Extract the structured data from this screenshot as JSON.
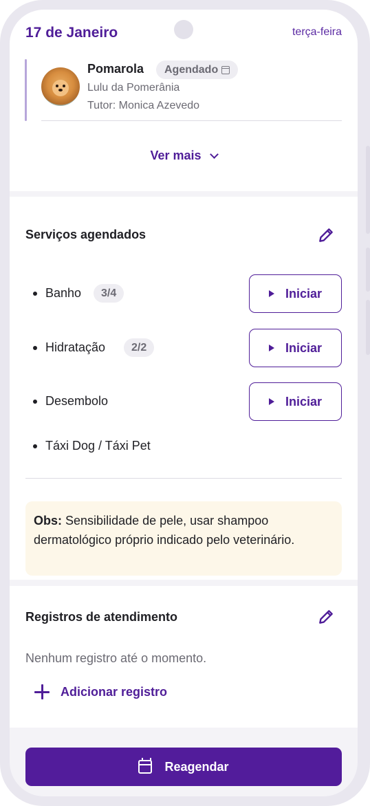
{
  "header": {
    "date": "17 de Janeiro",
    "weekday": "terça-feira"
  },
  "pet": {
    "name": "Pomarola",
    "status": "Agendado",
    "breed": "Lulu da Pomerânia",
    "tutor": "Tutor: Monica Azevedo",
    "status_icon": "calendar-icon"
  },
  "details": {
    "see_more_label": "Ver mais",
    "see_more_icon": "chevron-down-icon"
  },
  "services": {
    "title": "Serviços agendados",
    "edit_icon": "pencil-icon",
    "items": [
      {
        "name": "Banho",
        "count": "3/4",
        "action_label": "Iniciar"
      },
      {
        "name": "Hidratação",
        "count": "2/2",
        "action_label": "Iniciar"
      },
      {
        "name": "Desembolo",
        "count": "",
        "action_label": "Iniciar"
      },
      {
        "name": "Táxi Dog / Táxi Pet",
        "count": "",
        "action_label": ""
      }
    ],
    "obs_label": "Obs:",
    "obs_text": "Sensibilidade de pele, usar shampoo dermatológico próprio indicado pelo veterinário."
  },
  "records": {
    "title": "Registros de atendimento",
    "empty_text": "Nenhum registro até o momento.",
    "add_label": "Adicionar registro"
  },
  "actions": {
    "reschedule_label": "Reagendar"
  },
  "colors": {
    "accent": "#4f1d98",
    "primary_button": "#521c9b",
    "obs_background": "#fdf7e9",
    "badge_background": "#eeedf2"
  }
}
